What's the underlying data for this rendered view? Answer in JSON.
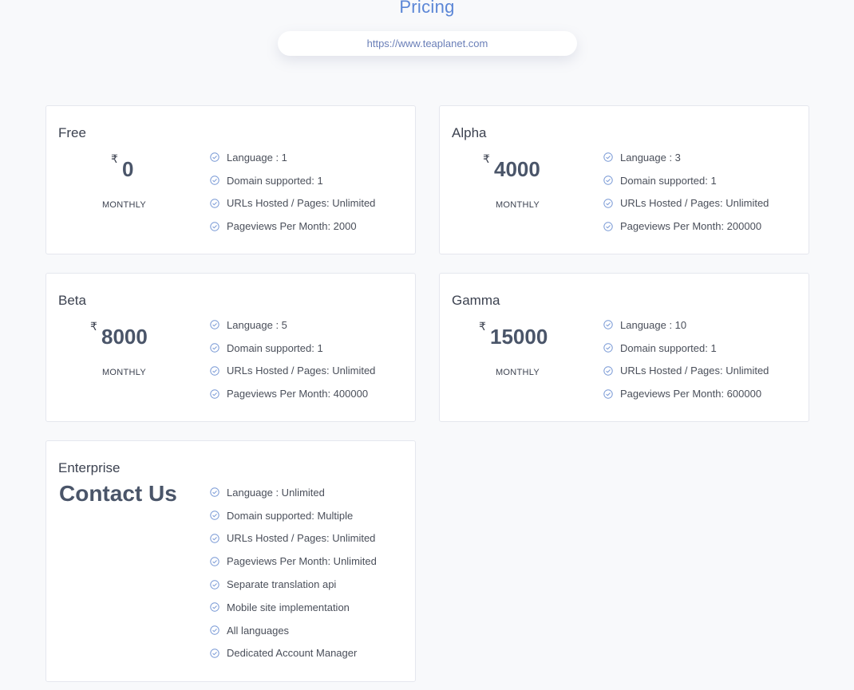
{
  "header": {
    "title": "Pricing",
    "url": "https://www.teaplanet.com"
  },
  "colors": {
    "accent": "#5b86d6",
    "price_text": "#4a5569",
    "check_icon": "#7a9ad6"
  },
  "plans": [
    {
      "name": "Free",
      "currency": "₹",
      "amount": "0",
      "period": "MONTHLY",
      "features": [
        "Language : 1",
        "Domain supported: 1",
        "URLs Hosted / Pages: Unlimited",
        "Pageviews Per Month: 2000"
      ]
    },
    {
      "name": "Alpha",
      "currency": "₹",
      "amount": "4000",
      "period": "MONTHLY",
      "features": [
        "Language : 3",
        "Domain supported: 1",
        "URLs Hosted / Pages: Unlimited",
        "Pageviews Per Month: 200000"
      ]
    },
    {
      "name": "Beta",
      "currency": "₹",
      "amount": "8000",
      "period": "MONTHLY",
      "features": [
        "Language : 5",
        "Domain supported: 1",
        "URLs Hosted / Pages: Unlimited",
        "Pageviews Per Month: 400000"
      ]
    },
    {
      "name": "Gamma",
      "currency": "₹",
      "amount": "15000",
      "period": "MONTHLY",
      "features": [
        "Language : 10",
        "Domain supported: 1",
        "URLs Hosted / Pages: Unlimited",
        "Pageviews Per Month: 600000"
      ]
    },
    {
      "name": "Enterprise",
      "price_text": "Contact Us",
      "features": [
        "Language : Unlimited",
        "Domain supported: Multiple",
        "URLs Hosted / Pages: Unlimited",
        "Pageviews Per Month: Unlimited",
        "Separate translation api",
        "Mobile site implementation",
        "All languages",
        "Dedicated Account Manager"
      ]
    }
  ]
}
